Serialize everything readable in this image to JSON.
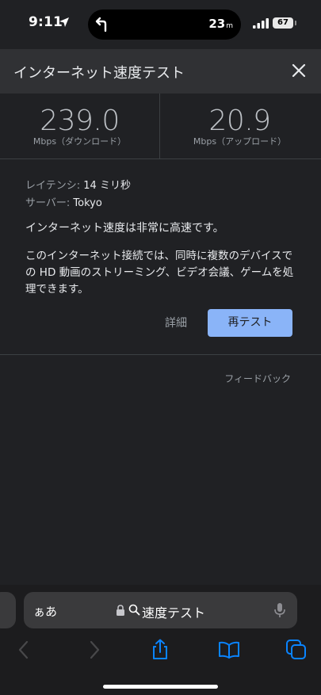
{
  "status_bar": {
    "time": "9:11",
    "nav_distance": "23",
    "nav_distance_unit": "m",
    "battery": "67"
  },
  "header": {
    "title": "インターネット速度テスト",
    "close_icon": "close-icon"
  },
  "speeds": {
    "download": {
      "value": "239.0",
      "label": "Mbps（ダウンロード）"
    },
    "upload": {
      "value": "20.9",
      "label": "Mbps（アップロード）"
    }
  },
  "info": {
    "latency_label": "レイテンシ:",
    "latency_value": "14 ミリ秒",
    "server_label": "サーバー:",
    "server_value": "Tokyo",
    "summary": "インターネット速度は非常に高速です。",
    "detail": "このインターネット接続では、同時に複数のデバイスでの HD 動画のストリーミング、ビデオ会議、ゲームを処理できます。"
  },
  "actions": {
    "details": "詳細",
    "retest": "再テスト",
    "feedback": "フィードバック"
  },
  "browser": {
    "aa": "ぁあ",
    "url": "速度テスト"
  },
  "colors": {
    "background": "#202124",
    "header": "#303134",
    "accent": "#8ab4f8"
  }
}
